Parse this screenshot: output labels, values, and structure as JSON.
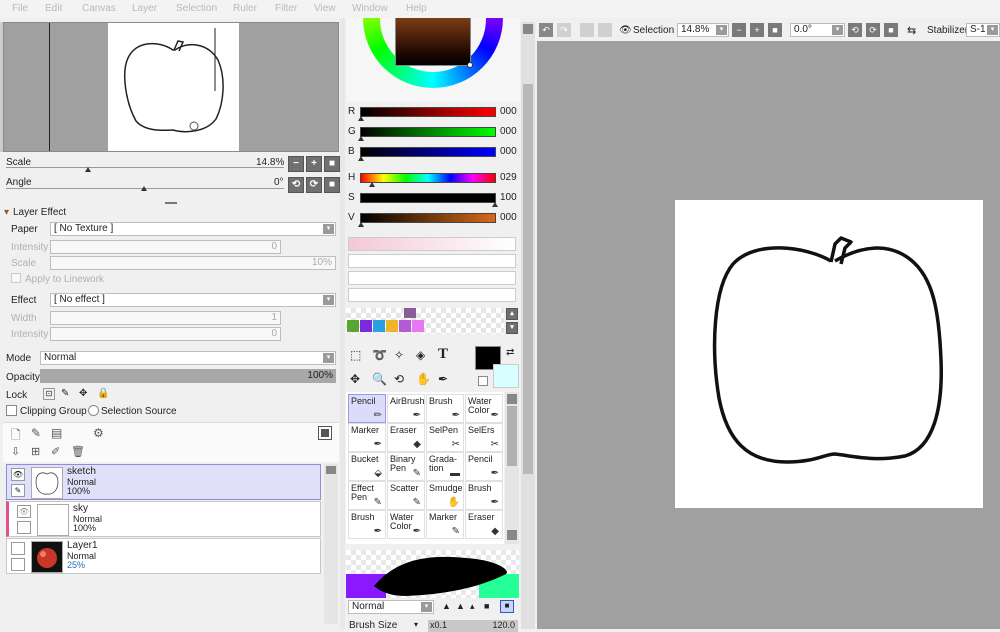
{
  "menu": [
    "File",
    "Edit",
    "Canvas",
    "Layer",
    "Selection",
    "Ruler",
    "Filter",
    "View",
    "Window",
    "Help"
  ],
  "navigator": {
    "scale_label": "Scale",
    "scale_value": "14.8%",
    "angle_label": "Angle",
    "angle_value": "0°"
  },
  "layer_effect": {
    "header": "Layer Effect",
    "paper_label": "Paper",
    "paper_value": "[ No Texture ]",
    "intensity_label": "Intensity",
    "intensity_value": "0",
    "scale_label": "Scale",
    "scale_value": "10%",
    "apply_label": "Apply to Linework",
    "effect_label": "Effect",
    "effect_value": "[ No effect ]",
    "width_label": "Width",
    "width_value": "1",
    "intensity2_label": "Intensity",
    "intensity2_value": "0"
  },
  "layer_props": {
    "mode_label": "Mode",
    "mode_value": "Normal",
    "opacity_label": "Opacity",
    "opacity_value": "100%",
    "lock_label": "Lock",
    "clipping_label": "Clipping Group",
    "selsource_label": "Selection Source"
  },
  "layers": [
    {
      "name": "sketch",
      "mode": "Normal",
      "opacity": "100%"
    },
    {
      "name": "sky",
      "mode": "Normal",
      "opacity": "100%"
    },
    {
      "name": "Layer1",
      "mode": "Normal",
      "opacity": "25%"
    }
  ],
  "color": {
    "rows": [
      {
        "label": "R",
        "value": "000"
      },
      {
        "label": "G",
        "value": "000"
      },
      {
        "label": "B",
        "value": "000"
      },
      {
        "label": "H",
        "value": "029"
      },
      {
        "label": "S",
        "value": "100"
      },
      {
        "label": "V",
        "value": "000"
      }
    ],
    "swatches": [
      "#5aa532",
      "#7a2be0",
      "#2aa0e0",
      "#f0b428",
      "#b45ad2",
      "#e678f0"
    ],
    "extra_swatch": "#8c5a96"
  },
  "tools": [
    {
      "label": "Pencil"
    },
    {
      "label": "AirBrush"
    },
    {
      "label": "Brush"
    },
    {
      "label": "Water Color"
    },
    {
      "label": "Marker"
    },
    {
      "label": "Eraser"
    },
    {
      "label": "SelPen"
    },
    {
      "label": "SelErs"
    },
    {
      "label": "Bucket"
    },
    {
      "label": "Binary Pen"
    },
    {
      "label": "Grada-tion"
    },
    {
      "label": "Pencil"
    },
    {
      "label": "Effect Pen"
    },
    {
      "label": "Scatter"
    },
    {
      "label": "Smudge"
    },
    {
      "label": "Brush"
    },
    {
      "label": "Brush"
    },
    {
      "label": "Water Color"
    },
    {
      "label": "Marker"
    },
    {
      "label": "Eraser"
    }
  ],
  "brush": {
    "mode_value": "Normal",
    "size_label": "Brush Size",
    "size_mult": "x0.1",
    "size_value": "120.0"
  },
  "toolbar": {
    "selection_label": "Selection",
    "zoom_value": "14.8%",
    "angle_value": "0.0°",
    "stabilizer_label": "Stabilizer",
    "stabilizer_value": "S-1"
  }
}
